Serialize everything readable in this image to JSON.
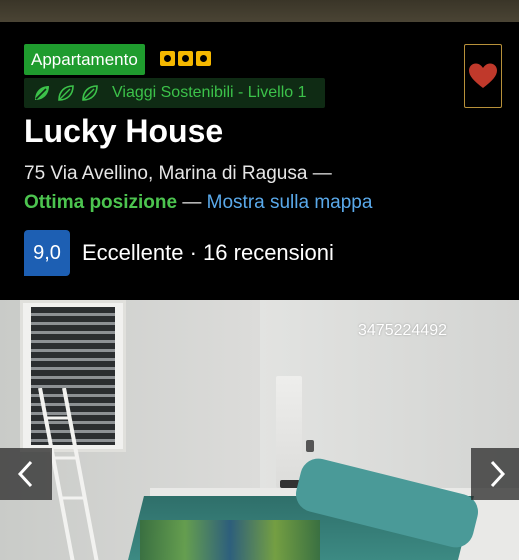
{
  "property": {
    "type_badge": "Appartamento",
    "star_rating": 3,
    "sustainability": {
      "label": "Viaggi Sostenibili - Livello 1",
      "leaf_count": 3,
      "leaf_filled": 1
    },
    "title": "Lucky House",
    "address": "75 Via Avellino, Marina di Ragusa —",
    "location_quality": "Ottima posizione",
    "location_separator": " — ",
    "map_link": "Mostra sulla mappa",
    "score": "9,0",
    "review_text": "Eccellente · 16 recensioni"
  },
  "gallery": {
    "phone_overlay": "3475224492",
    "prev_icon": "chevron-left-icon",
    "next_icon": "chevron-right-icon"
  },
  "colors": {
    "badge_green": "#1f9c2e",
    "star_yellow": "#f5b800",
    "score_blue": "#1d5fb3",
    "link_blue": "#5aa9ea",
    "good_green": "#4cc44f",
    "heart_red": "#c0392b"
  }
}
